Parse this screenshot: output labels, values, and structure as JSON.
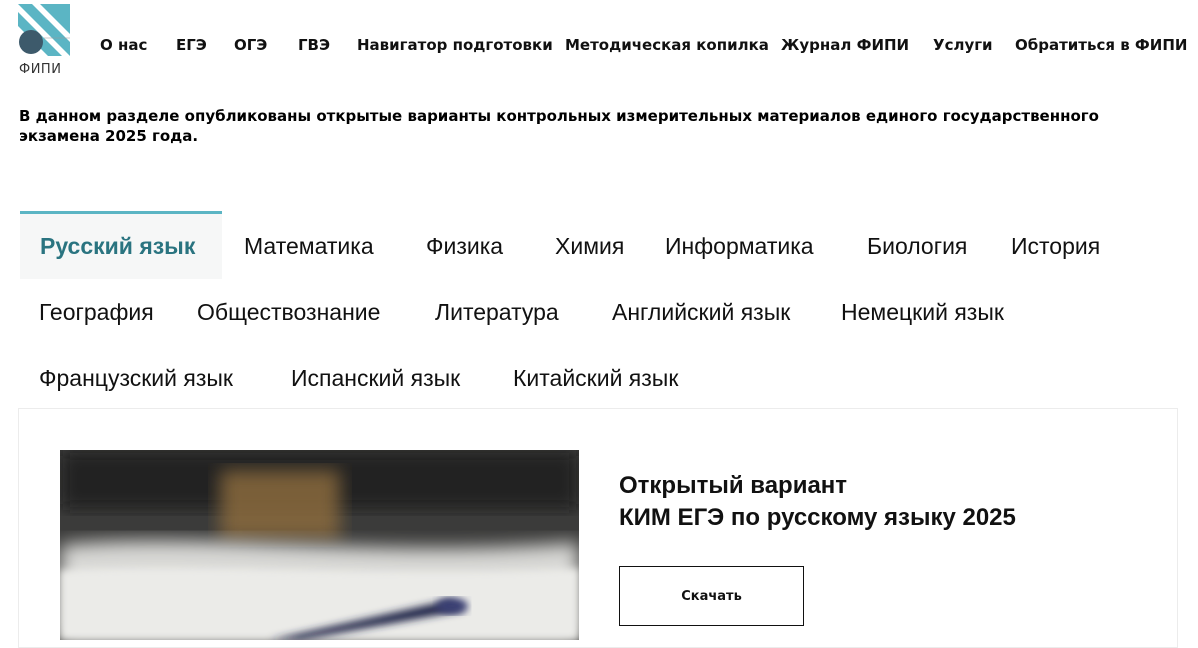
{
  "logo": {
    "text": "ФИПИ",
    "colors": {
      "teal": "#5bb5c4",
      "circle": "#3d5a6b"
    }
  },
  "nav": {
    "items": [
      {
        "label": "О нас"
      },
      {
        "label": "ЕГЭ"
      },
      {
        "label": "ОГЭ"
      },
      {
        "label": "ГВЭ"
      },
      {
        "label": "Навигатор подготовки"
      },
      {
        "label": "Методическая копилка"
      },
      {
        "label": "Журнал ФИПИ"
      },
      {
        "label": "Услуги"
      },
      {
        "label": "Обратиться в ФИПИ"
      }
    ]
  },
  "intro": {
    "text": "В данном разделе опубликованы открытые варианты контрольных измерительных материалов единого государственного экзамена 2025 года."
  },
  "tabs": {
    "active_color": "#2a7480",
    "accent_color": "#5bb5c4",
    "items": [
      {
        "label": "Русский язык",
        "active": true
      },
      {
        "label": "Математика"
      },
      {
        "label": "Физика"
      },
      {
        "label": "Химия"
      },
      {
        "label": "Информатика"
      },
      {
        "label": "Биология"
      },
      {
        "label": "История"
      },
      {
        "label": "География"
      },
      {
        "label": "Обществознание"
      },
      {
        "label": "Литература"
      },
      {
        "label": "Английский язык"
      },
      {
        "label": "Немецкий язык"
      },
      {
        "label": "Французский язык"
      },
      {
        "label": "Испанский язык"
      },
      {
        "label": "Китайский язык"
      }
    ]
  },
  "card": {
    "title_line1": "Открытый вариант",
    "title_line2": "КИМ ЕГЭ по русскому языку 2025",
    "download_label": "Скачать"
  }
}
